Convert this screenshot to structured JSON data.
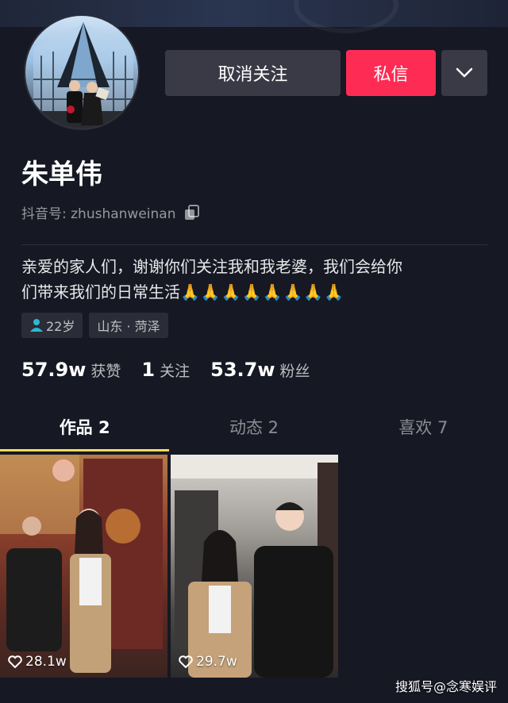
{
  "profile": {
    "name": "朱单伟",
    "handle": "抖音号: zhushanweinan",
    "bio_line1": "亲爱的家人们，谢谢你们关注我和我老婆，我们会给你",
    "bio_line2": "们带来我们的日常生活",
    "bio_emoji": "🙏🙏🙏🙏🙏🙏🙏🙏",
    "avatar_icon": "couple-photo-avatar"
  },
  "actions": {
    "unfollow_label": "取消关注",
    "message_label": "私信",
    "more_icon": "chevron-down-icon"
  },
  "tags": {
    "age": "22岁",
    "location": "山东 · 菏泽"
  },
  "stats": [
    {
      "value": "57.9w",
      "label": "获赞"
    },
    {
      "value": "1",
      "label": "关注"
    },
    {
      "value": "53.7w",
      "label": "粉丝"
    }
  ],
  "tabs": [
    {
      "label": "作品 2",
      "active": true
    },
    {
      "label": "动态 2",
      "active": false
    },
    {
      "label": "喜欢 7",
      "active": false
    }
  ],
  "videos": [
    {
      "likes": "28.1w"
    },
    {
      "likes": "29.7w"
    }
  ],
  "watermark": "搜狐号@念寒娱评",
  "colors": {
    "background": "#161823",
    "accent": "#fe2c55",
    "tab_indicator": "#fbd85e",
    "button_bg": "#3a3a46"
  }
}
